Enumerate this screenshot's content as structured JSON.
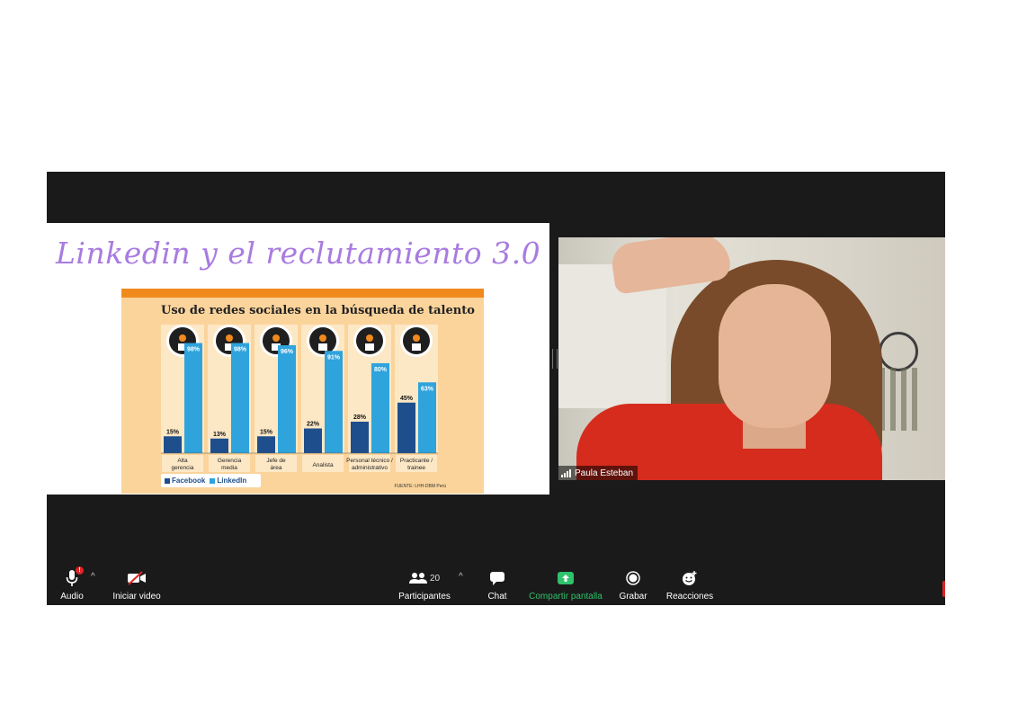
{
  "slide": {
    "title": "Linkedin y el reclutamiento 3.0",
    "chart_title": "Uso de redes sociales en la búsqueda de talento",
    "source": "FUENTE: LHH-DBM Perú",
    "colors": {
      "facebook": "#1e4f8c",
      "linkedin": "#2fa3dc",
      "panel": "#fbd49c",
      "accent": "#f08a1d",
      "title": "#a97be0"
    }
  },
  "chart_data": {
    "type": "bar",
    "title": "Uso de redes sociales en la búsqueda de talento",
    "categories": [
      "Alta gerencia",
      "Gerencia media",
      "Jefe de área",
      "Analista",
      "Personal técnico / administrativo",
      "Practicante / trainee"
    ],
    "category_lines": [
      [
        "Alta",
        "gerencia"
      ],
      [
        "Gerencia",
        "media"
      ],
      [
        "Jefe de",
        "área"
      ],
      [
        "Analista"
      ],
      [
        "Personal técnico /",
        "administrativo"
      ],
      [
        "Practicante /",
        "trainee"
      ]
    ],
    "series": [
      {
        "name": "Facebook",
        "values": [
          15,
          13,
          15,
          22,
          28,
          45
        ],
        "labels": [
          "15%",
          "13%",
          "15%",
          "22%",
          "28%",
          "45%"
        ]
      },
      {
        "name": "LinkedIn",
        "values": [
          98,
          98,
          96,
          91,
          80,
          63
        ],
        "labels": [
          "98%",
          "98%",
          "96%",
          "91%",
          "80%",
          "63%"
        ]
      }
    ],
    "ylim": [
      0,
      100
    ],
    "legend": "bottom-left",
    "icons": [
      "presenter-icon",
      "growth-chart-icon",
      "checklist-icon",
      "team-icon",
      "search-icon",
      "people-icon"
    ]
  },
  "participant": {
    "name": "Paula Esteban"
  },
  "toolbar": {
    "audio": "Audio",
    "video": "Iniciar video",
    "participants": "Participantes",
    "participants_count": "20",
    "chat": "Chat",
    "share": "Compartir pantalla",
    "record": "Grabar",
    "reactions": "Reacciones",
    "audio_badge": "!"
  }
}
